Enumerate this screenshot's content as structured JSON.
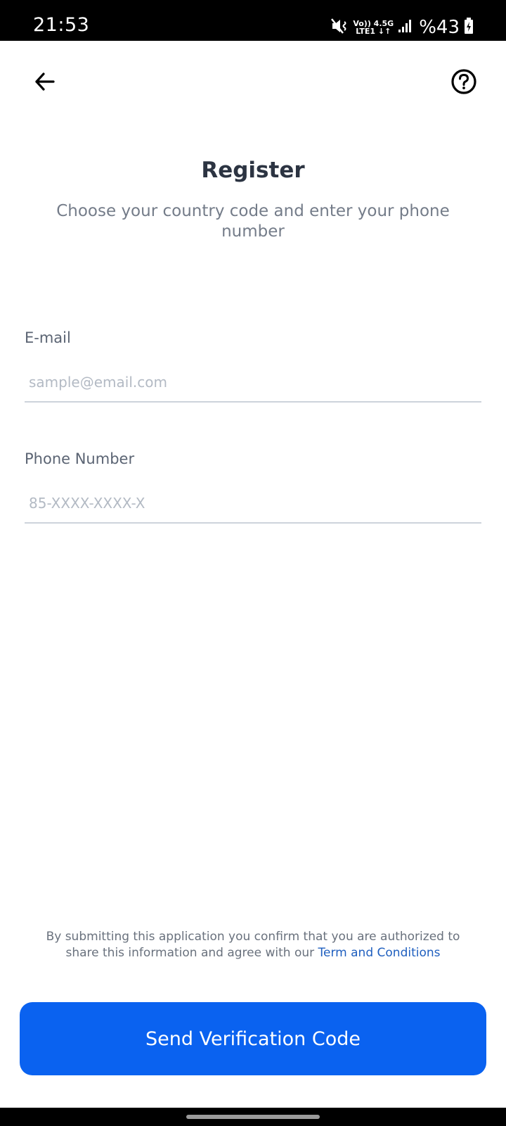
{
  "status_bar": {
    "time": "21:53",
    "network_top": "Vo)) 4.5G",
    "network_bottom": "LTE1 ↓↑",
    "battery": "%43",
    "icons": [
      "mute-vibrate-icon",
      "signal-icon",
      "battery-charging-icon"
    ]
  },
  "header": {
    "back_icon": "arrow-left-icon",
    "help_icon": "question-circle-icon"
  },
  "main": {
    "title": "Register",
    "subtitle": "Choose your country code and enter your phone number"
  },
  "form": {
    "email": {
      "label": "E-mail",
      "value": "",
      "placeholder": "sample@email.com"
    },
    "phone": {
      "label": "Phone Number",
      "value": "",
      "placeholder": "85-XXXX-XXXX-X"
    }
  },
  "footer": {
    "disclaimer_text": "By submitting this application you confirm that you are authorized to share this information and agree with our ",
    "terms_link": "Term and Conditions",
    "submit_label": "Send Verification Code"
  },
  "colors": {
    "accent": "#0a62f0",
    "link": "#1f5fbf",
    "title": "#2c3442",
    "subtitle": "#747c89"
  }
}
